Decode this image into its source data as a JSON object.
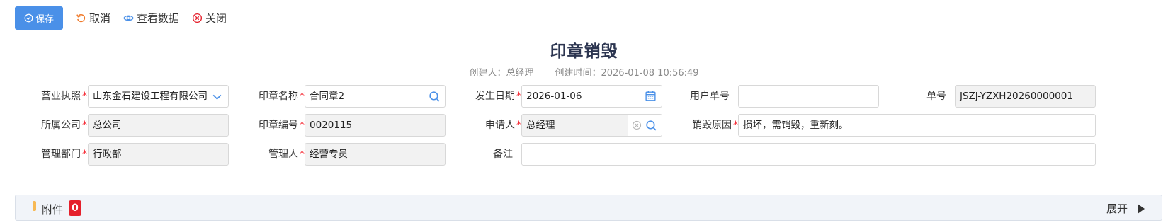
{
  "toolbar": {
    "save_label": "保存",
    "cancel_label": "取消",
    "view_data_label": "查看数据",
    "close_label": "关闭"
  },
  "header": {
    "title": "印章销毁",
    "creator_label": "创建人：",
    "creator": "总经理",
    "created_time_label": "创建时间：",
    "created_time": "2026-01-08 10:56:49"
  },
  "form": {
    "business_license": {
      "label": "营业执照",
      "required": "*",
      "value": "山东金石建设工程有限公司"
    },
    "seal_name": {
      "label": "印章名称",
      "required": "*",
      "value": "合同章2"
    },
    "occur_date": {
      "label": "发生日期",
      "required": "*",
      "value": "2026-01-06"
    },
    "user_order_no": {
      "label": "用户单号",
      "value": ""
    },
    "order_no": {
      "label": "单号",
      "value": "JSZJ-YZXH20260000001"
    },
    "company": {
      "label": "所属公司",
      "required": "*",
      "value": "总公司"
    },
    "seal_code": {
      "label": "印章编号",
      "required": "*",
      "value": "0020115"
    },
    "applicant": {
      "label": "申请人",
      "required": "*",
      "value": "总经理"
    },
    "destroy_reason": {
      "label": "销毁原因",
      "required": "*",
      "value": "损坏，需销毁，重新刻。"
    },
    "department": {
      "label": "管理部门",
      "required": "*",
      "value": "行政部"
    },
    "manager": {
      "label": "管理人",
      "required": "*",
      "value": "经营专员"
    },
    "remark": {
      "label": "备注",
      "value": ""
    }
  },
  "attachments": {
    "title": "附件",
    "count": "0",
    "expand_label": "展开"
  },
  "colors": {
    "primary": "#4a90e8",
    "required": "#f5222d",
    "badge": "#e5202c",
    "title": "#2c3550"
  }
}
